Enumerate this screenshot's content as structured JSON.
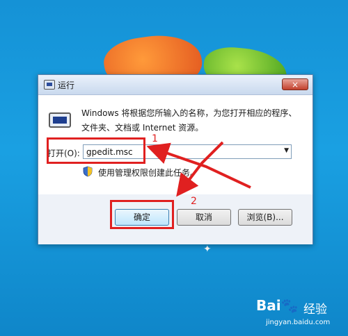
{
  "dialog": {
    "title": "运行",
    "close_glyph": "×",
    "description": "Windows 将根据您所输入的名称，为您打开相应的程序、文件夹、文档或 Internet 资源。",
    "open_label": "打开(O):",
    "open_value": "gpedit.msc",
    "admin_note": "使用管理权限创建此任务。",
    "buttons": {
      "ok": "确定",
      "cancel": "取消",
      "browse": "浏览(B)..."
    }
  },
  "annotations": {
    "step1": "1",
    "step2": "2"
  },
  "watermark": {
    "logo": "Bai🐾",
    "brand": "经验",
    "url": "jingyan.baidu.com"
  },
  "icons": [
    "run-icon",
    "close-icon",
    "dropdown-arrow-icon",
    "uac-shield-icon",
    "windows-logo",
    "sparkle-icon"
  ],
  "colors": {
    "annotation": "#e02020",
    "desktop": "#1592d6"
  }
}
